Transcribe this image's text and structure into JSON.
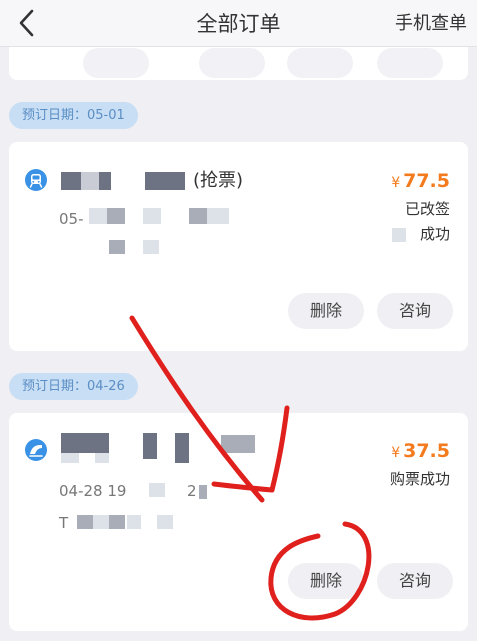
{
  "header": {
    "title": "全部订单",
    "right_link": "手机查单",
    "icons": {
      "back": "chevron-left-icon",
      "train": "train-icon"
    }
  },
  "orders": [
    {
      "booking_date_label": "预订日期：05-01",
      "train_name_visible": "(抢票)",
      "depart_partial": "05-",
      "price_symbol": "¥",
      "price": "77.5",
      "status_lines": [
        "已改签",
        "成功"
      ],
      "actions": [
        "删除",
        "咨询"
      ]
    },
    {
      "booking_date_label": "预订日期：04-26",
      "depart_partial": "04-28 19",
      "depart_partial_2": "2",
      "extra_partial": "T",
      "price_symbol": "¥",
      "price": "37.5",
      "status_lines": [
        "购票成功"
      ],
      "actions": [
        "删除",
        "咨询"
      ]
    }
  ],
  "colors": {
    "accent_orange": "#f37b1d",
    "date_pill_bg": "#c7def5",
    "date_pill_text": "#5b8ec4",
    "train_icon": "#3a92e6",
    "annotation_red": "#e0201c"
  }
}
